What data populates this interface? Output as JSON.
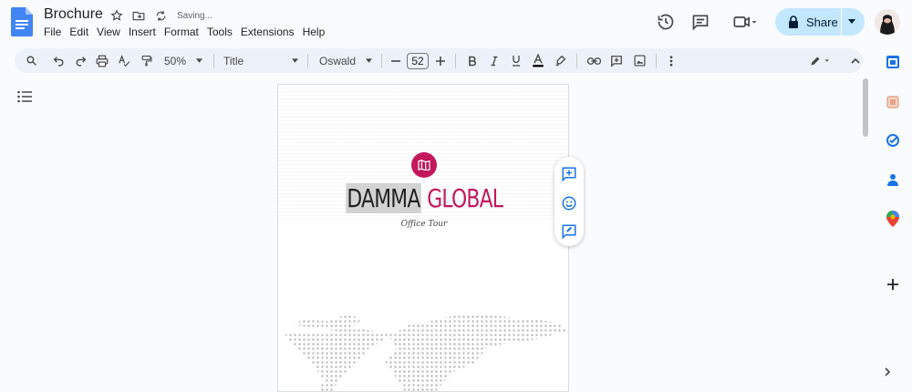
{
  "doc": {
    "title": "Brochure",
    "status": "Saving..."
  },
  "menu": [
    "File",
    "Edit",
    "View",
    "Insert",
    "Format",
    "Tools",
    "Extensions",
    "Help"
  ],
  "header": {
    "share_label": "Share"
  },
  "toolbar": {
    "zoom": "50%",
    "style": "Title",
    "font": "Oswald",
    "font_size": "52"
  },
  "page": {
    "heading_part1": "DAMMA",
    "heading_part2": "GLOBAL",
    "subtitle": "Office Tour"
  },
  "colors": {
    "accent": "#c2185b",
    "share_bg": "#c2e7ff",
    "toolbar_bg": "#edf2fa",
    "docs_blue": "#4285f4"
  },
  "icons": [
    "docs-logo-icon",
    "star-icon",
    "move-folder-icon",
    "sync-icon",
    "history-icon",
    "comments-icon",
    "meet-icon",
    "lock-icon",
    "search-icon",
    "undo-icon",
    "redo-icon",
    "print-icon",
    "spellcheck-icon",
    "paint-format-icon",
    "bold-icon",
    "italic-icon",
    "underline-icon",
    "text-color-icon",
    "highlight-icon",
    "link-icon",
    "add-comment-icon",
    "image-icon",
    "more-icon",
    "edit-mode-icon",
    "collapse-icon",
    "outline-icon",
    "calendar-icon",
    "keep-icon",
    "tasks-icon",
    "contacts-icon",
    "maps-icon",
    "add-icon",
    "emoji-icon",
    "suggest-edit-icon"
  ]
}
